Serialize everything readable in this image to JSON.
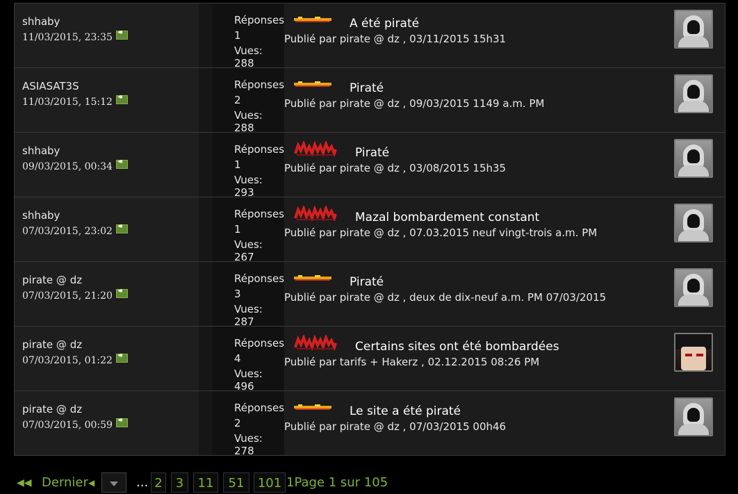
{
  "labels": {
    "replies": "Réponses:",
    "views": "Vues:"
  },
  "threads": [
    {
      "user": "shhaby",
      "date": "11/03/2015, 23:35",
      "replies": "1",
      "views": "Vues: 288",
      "prefix": "prefix-banner",
      "title": "A été piraté",
      "byline": "Publié par pirate @ dz , 03/11/2015 15h31",
      "avatar": "hooded-avatar"
    },
    {
      "user": "ASIASAT3S",
      "date": "11/03/2015, 15:12",
      "replies": "2",
      "views": "Vues: 288",
      "prefix": "prefix-banner",
      "title": "Piraté",
      "byline": "Publié par pirate @ dz , 09/03/2015 1149 a.m. PM",
      "avatar": "hooded-avatar"
    },
    {
      "user": "shhaby",
      "date": "09/03/2015, 00:34",
      "replies": "1",
      "views": "Vues: 293",
      "prefix": "prefix-red-graffiti",
      "title": "Piraté",
      "byline": "Publié par pirate @ dz , 03/08/2015 15h35",
      "avatar": "hooded-avatar"
    },
    {
      "user": "shhaby",
      "date": "07/03/2015, 23:02",
      "replies": "1",
      "views": "Vues: 267",
      "prefix": "prefix-red-graffiti",
      "title": "Mazal bombardement constant",
      "byline": "Publié par pirate @ dz , 07.03.2015 neuf vingt-trois a.m. PM",
      "avatar": "hooded-avatar"
    },
    {
      "user": "pirate @ dz",
      "date": "07/03/2015, 21:20",
      "replies": "3",
      "views": "Vues: 287",
      "prefix": "prefix-banner",
      "title": "Piraté",
      "byline": "Publié par pirate @ dz , deux de dix-neuf a.m. PM 07/03/2015",
      "avatar": "hooded-avatar"
    },
    {
      "user": "pirate @ dz",
      "date": "07/03/2015, 01:22",
      "replies": "4",
      "views": "Vues: 496",
      "prefix": "prefix-red-graffiti",
      "title": "Certains sites ont été bombardées",
      "byline": "Publié par tarifs + Hakerz , 02.12.2015 08:26 PM",
      "avatar": "anime-avatar"
    },
    {
      "user": "pirate @ dz",
      "date": "07/03/2015, 00:59",
      "replies": "2",
      "views": "Vues: 278",
      "prefix": "prefix-banner",
      "title": "Le site a été piraté",
      "byline": "Publié par pirate @ dz , 07/03/2015 00h46",
      "avatar": "hooded-avatar"
    }
  ],
  "pager": {
    "last": "Dernier",
    "dots": "...",
    "pages": [
      "2",
      "3",
      "11",
      "51",
      "101"
    ],
    "trailing": "1Page 1 sur 105"
  },
  "colors": {
    "accent": "#7fb238",
    "row_bg": "#1c1c1c",
    "border": "#3a3a3a"
  }
}
